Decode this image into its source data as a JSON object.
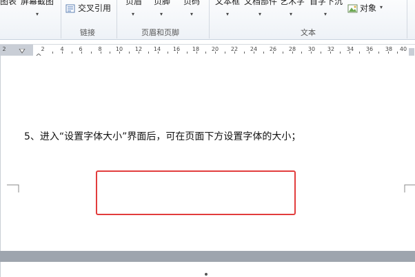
{
  "ribbon": {
    "cut_labels": [
      "图表",
      "屏幕截图",
      "页眉",
      "页脚",
      "页码",
      "文本框",
      "文档部件",
      "艺术字",
      "首字下沉"
    ],
    "cross_ref_label": "交叉引用",
    "object_label": "对象",
    "groups": {
      "links": "链接",
      "header_footer": "页眉和页脚",
      "text": "文本"
    }
  },
  "ruler": {
    "numbers": [
      "2",
      "2",
      "4",
      "6",
      "8",
      "10",
      "12",
      "14",
      "16",
      "18",
      "20",
      "22",
      "24",
      "26",
      "28",
      "30",
      "32",
      "34",
      "36",
      "38",
      "40"
    ]
  },
  "document": {
    "body_text": "5、进入“设置字体大小”界面后，可在页面下方设置字体的大小；"
  },
  "colors": {
    "highlight": "#e23c3c",
    "ribbon_bg": "#eef2f7"
  }
}
